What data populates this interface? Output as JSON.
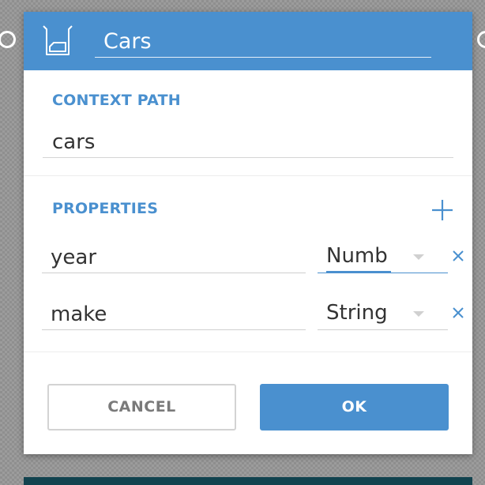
{
  "header": {
    "title_value": "Cars",
    "icon": "collection-icon",
    "background_color": "#4a90cf"
  },
  "context_path": {
    "label": "CONTEXT PATH",
    "value": "cars"
  },
  "properties": {
    "label": "PROPERTIES",
    "add_icon": "plus-icon",
    "remove_icon": "close-icon",
    "rows": [
      {
        "name": "year",
        "type": "Numb",
        "focused": true
      },
      {
        "name": "make",
        "type": "String",
        "focused": false
      }
    ]
  },
  "actions": {
    "cancel_label": "CANCEL",
    "ok_label": "OK"
  },
  "colors": {
    "accent": "#4a90cf",
    "backdrop": "#9c9c9c",
    "footer_strip": "#12434f"
  }
}
